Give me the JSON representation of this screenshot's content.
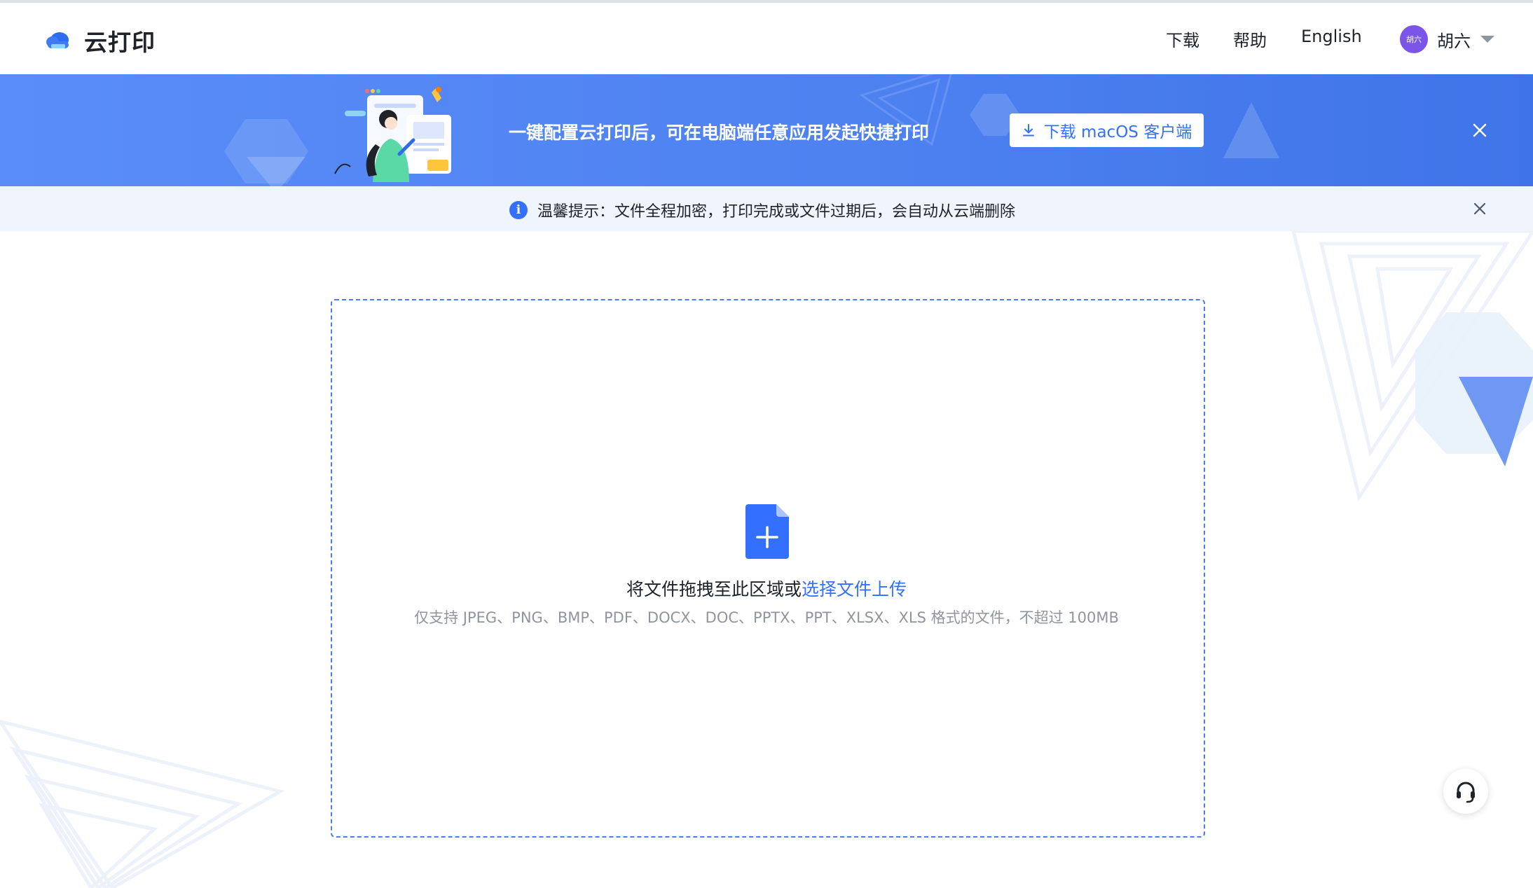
{
  "app": {
    "title": "云打印",
    "logo_icon": "cloud-printer-icon"
  },
  "header": {
    "nav": {
      "download": "下载",
      "help": "帮助",
      "language": "English"
    },
    "user": {
      "avatar_text": "胡六",
      "name": "胡六",
      "menu_icon": "caret-down-icon"
    }
  },
  "banner": {
    "text": "一键配置云打印后，可在电脑端任意应用发起快捷打印",
    "button_label": "下载 macOS 客户端",
    "button_icon": "download-icon",
    "close_icon": "close-icon"
  },
  "tip": {
    "icon": "info-icon",
    "icon_glyph": "i",
    "text": "温馨提示：文件全程加密，打印完成或文件过期后，会自动从云端删除",
    "close_icon": "close-icon"
  },
  "upload": {
    "icon": "file-add-icon",
    "prompt_prefix": "将文件拖拽至此区域或",
    "prompt_link": "选择文件上传",
    "hint": "仅支持 JPEG、PNG、BMP、PDF、DOCX、DOC、PPTX、PPT、XLSX、XLS 格式的文件，不超过 100MB"
  },
  "service": {
    "icon": "headset-icon"
  },
  "colors": {
    "accent": "#3370ff",
    "banner": "#5588f5",
    "tip_background": "#f0f4fd",
    "avatar": "#7a55e8",
    "hint_text": "#8f959e"
  }
}
